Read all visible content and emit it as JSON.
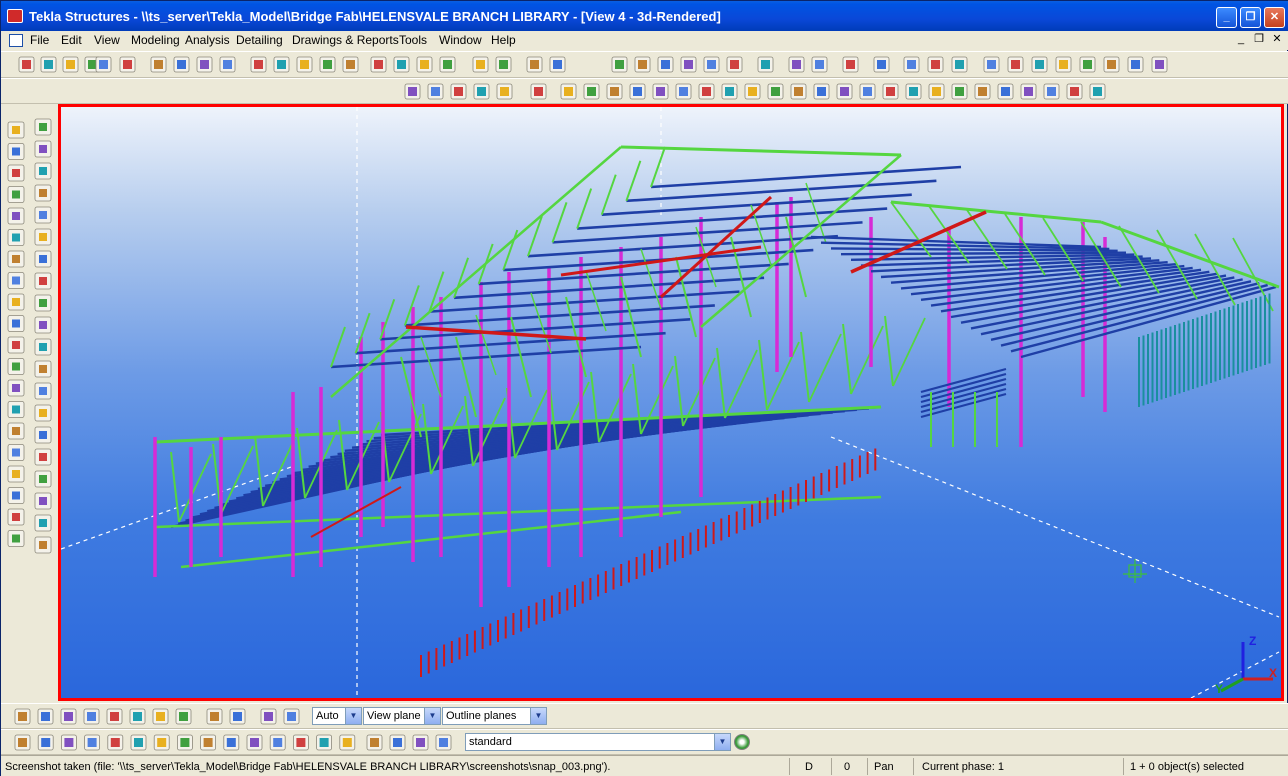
{
  "window": {
    "title": "Tekla Structures - \\\\ts_server\\Tekla_Model\\Bridge Fab\\HELENSVALE BRANCH LIBRARY - [View 4 - 3d-Rendered]",
    "minimize_label": "_",
    "maximize_label": "❐",
    "close_label": "✕"
  },
  "menu": {
    "items": [
      "File",
      "Edit",
      "View",
      "Modeling",
      "Analysis",
      "Detailing",
      "Drawings & Reports",
      "Tools",
      "Window",
      "Help"
    ],
    "mdi_minimize": "_",
    "mdi_restore": "❐",
    "mdi_close": "✕"
  },
  "viewport": {
    "name": "View 4 - 3d-Rendered",
    "colors": {
      "columns": "#d62bd6",
      "beams_green": "#55d640",
      "purlins_blue": "#1f3fa6",
      "highlight_red": "#d01818",
      "teal": "#1a8f9e",
      "border": "#ff0000"
    }
  },
  "bottom_toolbar": {
    "snap_depth": "Auto",
    "plane": "View plane",
    "planes_mode": "Outline planes",
    "filter": "standard"
  },
  "status": {
    "message": "Screenshot taken (file: '\\\\ts_server\\Tekla_Model\\Bridge Fab\\HELENSVALE BRANCH LIBRARY\\screenshots\\snap_003.png').",
    "mode_d": "D",
    "zero": "0",
    "pan": "Pan",
    "phase": "Current phase: 1",
    "selection": "1 + 0 object(s) selected"
  }
}
